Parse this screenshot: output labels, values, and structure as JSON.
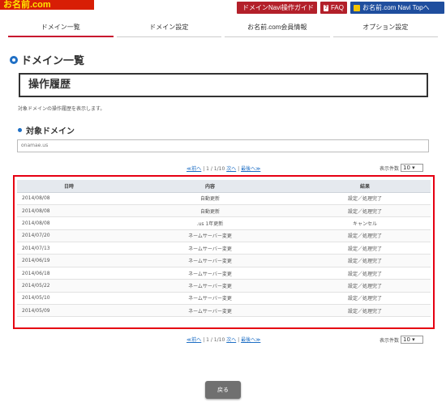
{
  "header": {
    "logo_text": "お名前.com",
    "links": [
      {
        "label": "ドメインNavi操作ガイド"
      },
      {
        "label": "FAQ"
      },
      {
        "label": "お名前.com Navi Topへ"
      }
    ]
  },
  "tabs": [
    {
      "label": "ドメイン一覧"
    },
    {
      "label": "ドメイン設定"
    },
    {
      "label": "お名前.com会員情報"
    },
    {
      "label": "オプション設定"
    }
  ],
  "page_title": "ドメイン一覧",
  "section_title": "操作履歴",
  "description": "対象ドメインの操作履歴を表示します。",
  "domain_section": {
    "title": "対象ドメイン",
    "value": "onamae.us"
  },
  "pager": {
    "prev_label": "≪前へ",
    "page_text": "1 / 1/10",
    "next_label": "次へ",
    "last_label": "最後へ≫",
    "per_page_label": "表示件数",
    "per_page_value": "10 ▾"
  },
  "table": {
    "headers": [
      "日時",
      "内容",
      "結果"
    ],
    "rows": [
      {
        "date": "2014/08/08",
        "content": "自動更新",
        "result": "設定／処理完了"
      },
      {
        "date": "2014/08/08",
        "content": "自動更新",
        "result": "設定／処理完了"
      },
      {
        "date": "2014/08/08",
        "content": ".us 1年更新",
        "result": "キャンセル"
      },
      {
        "date": "2014/07/20",
        "content": "ネームサーバー変更",
        "result": "設定／処理完了"
      },
      {
        "date": "2014/07/13",
        "content": "ネームサーバー変更",
        "result": "設定／処理完了"
      },
      {
        "date": "2014/06/19",
        "content": "ネームサーバー変更",
        "result": "設定／処理完了"
      },
      {
        "date": "2014/06/18",
        "content": "ネームサーバー変更",
        "result": "設定／処理完了"
      },
      {
        "date": "2014/05/22",
        "content": "ネームサーバー変更",
        "result": "設定／処理完了"
      },
      {
        "date": "2014/05/10",
        "content": "ネームサーバー変更",
        "result": "設定／処理完了"
      },
      {
        "date": "2014/05/09",
        "content": "ネームサーバー変更",
        "result": "設定／処理完了"
      }
    ]
  },
  "back_button": "戻る",
  "colors": {
    "accent_red": "#e60012",
    "brand_blue": "#1f6fc5"
  }
}
